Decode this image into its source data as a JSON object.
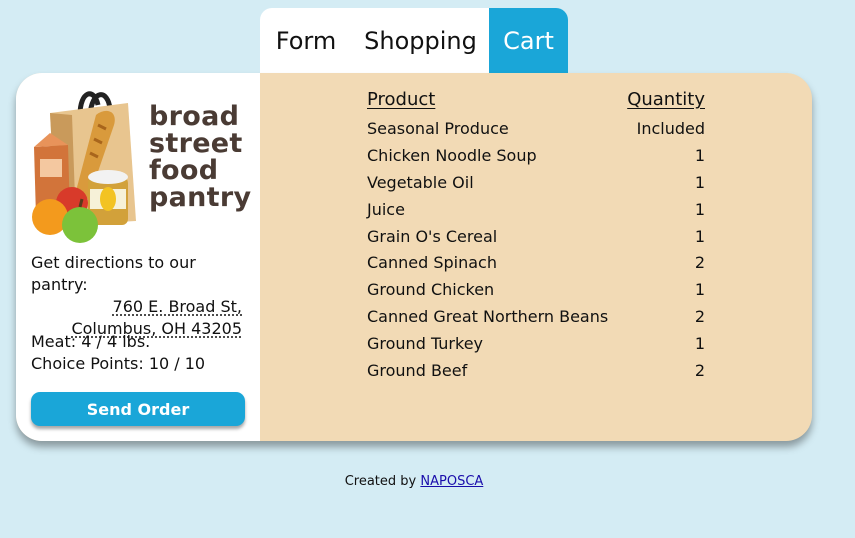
{
  "tabs": [
    {
      "label": "Form"
    },
    {
      "label": "Shopping"
    },
    {
      "label": "Cart",
      "active": true
    }
  ],
  "sidebar": {
    "logo_lines": [
      "broad",
      "street",
      "food",
      "pantry"
    ],
    "directions_label": "Get directions to our pantry:",
    "address_line1": "760 E. Broad St,",
    "address_line2": "Columbus, OH 43205",
    "meat": "Meat: 4 / 4 lbs.",
    "choice_points": "Choice Points: 10 / 10",
    "send_button": "Send Order"
  },
  "cart": {
    "headers": {
      "product": "Product",
      "quantity": "Quantity"
    },
    "items": [
      {
        "product": "Seasonal Produce",
        "quantity": "Included"
      },
      {
        "product": "Chicken Noodle Soup",
        "quantity": "1"
      },
      {
        "product": "Vegetable Oil",
        "quantity": "1"
      },
      {
        "product": "Juice",
        "quantity": "1"
      },
      {
        "product": "Grain O's Cereal",
        "quantity": "1"
      },
      {
        "product": "Canned Spinach",
        "quantity": "2"
      },
      {
        "product": "Ground Chicken",
        "quantity": "1"
      },
      {
        "product": "Canned Great Northern Beans",
        "quantity": "2"
      },
      {
        "product": "Ground Turkey",
        "quantity": "1"
      },
      {
        "product": "Ground Beef",
        "quantity": "2"
      }
    ]
  },
  "footer": {
    "prefix": "Created by",
    "link": "NAPOSCA"
  },
  "colors": {
    "accent": "#1aa6d8",
    "background": "#d4ecf4",
    "panel": "#f2dab5"
  }
}
